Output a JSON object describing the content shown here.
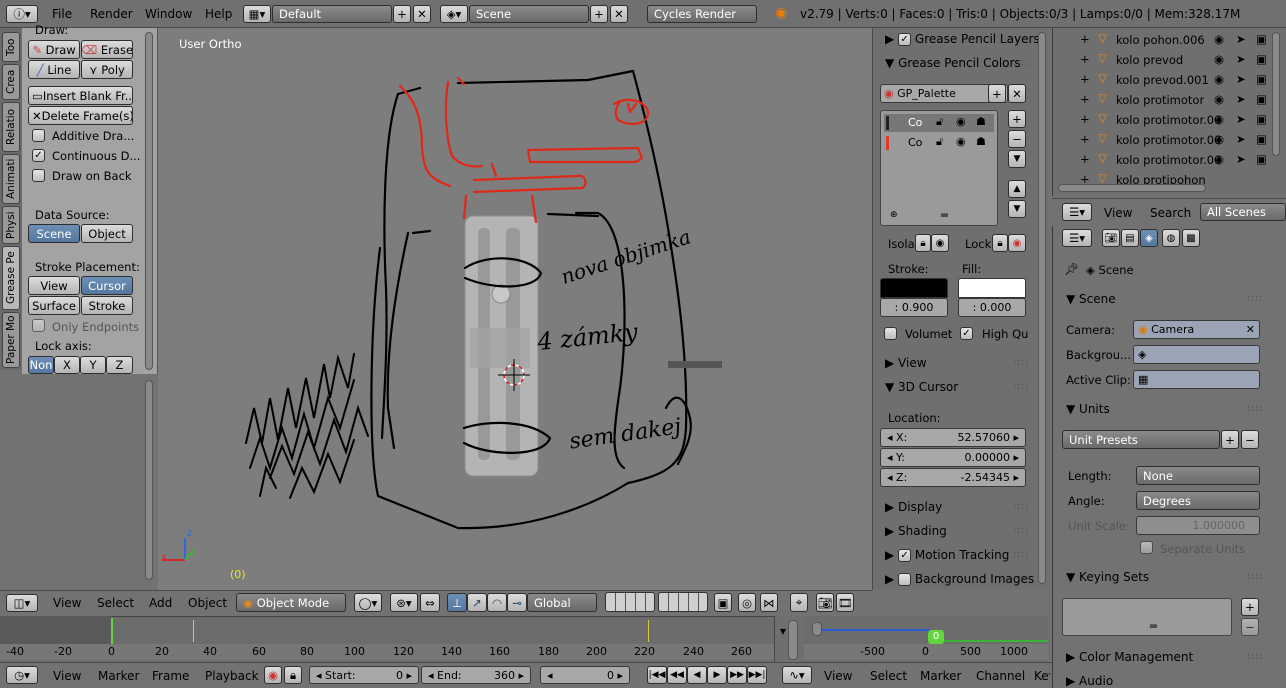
{
  "top_bar": {
    "menus": [
      "File",
      "Render",
      "Window",
      "Help"
    ],
    "screen_layout": "Default",
    "scene": "Scene",
    "render_engine": "Cycles Render",
    "stats": "v2.79 | Verts:0 | Faces:0 | Tris:0 | Objects:0/3 | Lamps:0/0 | Mem:328.17M"
  },
  "tool_tabs": [
    "Too",
    "Crea",
    "Relatio",
    "Animati",
    "Physi",
    "Grease Pe",
    "Paper Mo"
  ],
  "tool_shelf": {
    "draw_header": "Draw:",
    "draw": "Draw",
    "erase": "Erase",
    "line": "Line",
    "poly": "Poly",
    "insert_blank": "Insert Blank Fr...",
    "delete_frames": "Delete Frame(s)",
    "additive_draw": "Additive Dra...",
    "continuous_draw": "Continuous D...",
    "draw_on_back": "Draw on Back",
    "data_source": "Data Source:",
    "scene_btn": "Scene",
    "object_btn": "Object",
    "stroke_placement": "Stroke Placement:",
    "view_btn": "View",
    "cursor_btn": "Cursor",
    "surface_btn": "Surface",
    "stroke_btn": "Stroke",
    "only_endpoints": "Only Endpoints",
    "lock_axis": "Lock axis:",
    "axis": [
      "Non",
      "X",
      "Y",
      "Z"
    ]
  },
  "viewport": {
    "label": "User Ortho",
    "frame_indicator": "(0)",
    "handwriting": [
      "nova objimka",
      "4 zámky",
      "sem dakej"
    ]
  },
  "properties": {
    "gp_layers": "Grease Pencil Layers",
    "gp_colors": "Grease Pencil Colors",
    "palette": "GP_Palette",
    "color_items": [
      {
        "name": "Co",
        "swatch": "#222222"
      },
      {
        "name": "Co",
        "swatch": "#e03a2a"
      }
    ],
    "isolate": "Isola",
    "lock": "Lock:",
    "stroke_label": "Stroke:",
    "fill_label": "Fill:",
    "stroke_value": ": 0.900",
    "fill_value": ": 0.000",
    "volumetric": "Volumet",
    "high_quality": "High Qu",
    "view": "View",
    "cursor_3d": "3D Cursor",
    "location": "Location:",
    "x": "X:",
    "x_val": "52.57060",
    "y": "Y:",
    "y_val": "0.00000",
    "z": "Z:",
    "z_val": "-2.54345",
    "display": "Display",
    "shading": "Shading",
    "motion_tracking": "Motion Tracking",
    "background_images": "Background Images"
  },
  "outliner": {
    "items": [
      "kolo pohon.006",
      "kolo prevod",
      "kolo prevod.001",
      "kolo protimotor",
      "kolo protimotor.00",
      "kolo protimotor.00",
      "kolo protimotor.00",
      "kolo protipohon"
    ],
    "menus": [
      "View",
      "Search"
    ],
    "filter": "All Scenes"
  },
  "scene_props": {
    "breadcrumb": "Scene",
    "scene_panel": "Scene",
    "camera_label": "Camera:",
    "camera_value": "Camera",
    "background_label": "Backgrou...",
    "active_clip_label": "Active Clip:",
    "units_panel": "Units",
    "unit_presets": "Unit Presets",
    "length_label": "Length:",
    "length_value": "None",
    "angle_label": "Angle:",
    "angle_value": "Degrees",
    "unit_scale_label": "Unit Scale:",
    "unit_scale_value": "1.000000",
    "separate_units": "Separate Units",
    "keying_sets": "Keying Sets",
    "color_management": "Color Management",
    "audio": "Audio"
  },
  "view3d_header": {
    "menus": [
      "View",
      "Select",
      "Add",
      "Object"
    ],
    "mode": "Object Mode",
    "orientation": "Global"
  },
  "timeline": {
    "ruler": [
      "-40",
      "-20",
      "0",
      "20",
      "40",
      "60",
      "80",
      "100",
      "120",
      "140",
      "160",
      "180",
      "200",
      "220",
      "240",
      "260"
    ],
    "menus": [
      "View",
      "Marker",
      "Frame",
      "Playback"
    ],
    "start_label": "Start:",
    "start_value": "0",
    "end_label": "End:",
    "end_value": "360",
    "current_frame": "0"
  },
  "graph": {
    "ruler": [
      "-500",
      "0",
      "500",
      "1000"
    ],
    "frame": "0",
    "menus": [
      "View",
      "Select",
      "Marker",
      "Channel",
      "Key"
    ]
  }
}
